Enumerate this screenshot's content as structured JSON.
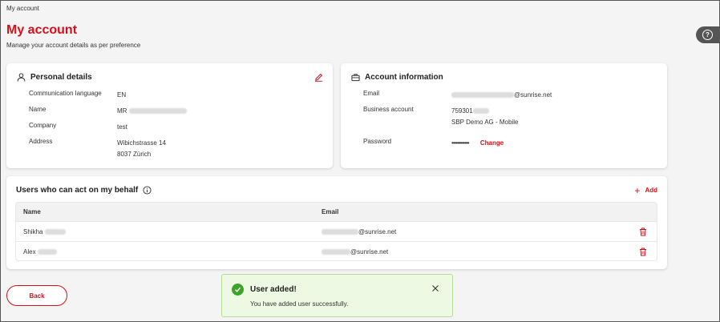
{
  "breadcrumb": "My account",
  "page": {
    "title": "My account",
    "subtitle": "Manage your account details as per preference"
  },
  "help": {
    "label": "?",
    "icon": "help-icon"
  },
  "personal": {
    "title": "Personal details",
    "rows": [
      {
        "label": "Communication language",
        "value": "EN"
      },
      {
        "label": "Name",
        "value": "MR"
      },
      {
        "label": "Company",
        "value": "test"
      },
      {
        "label": "Address",
        "line1": "Wibichstrasse 14",
        "line2": "8037 Zürich"
      }
    ]
  },
  "account": {
    "title": "Account information",
    "email_label": "Email",
    "email_suffix": "@sunrise.net",
    "business_label": "Business account",
    "business_prefix": "759301",
    "business_name": "SBP Demo AG - Mobile",
    "password_label": "Password",
    "password_mask": "••••••••••••",
    "change_label": "Change"
  },
  "users": {
    "title": "Users who can act on my behalf",
    "add_label": "Add",
    "columns": [
      "Name",
      "Email"
    ],
    "rows": [
      {
        "name": "Shikha",
        "email_suffix": "@sunrise.net"
      },
      {
        "name": "Alex",
        "email_suffix": "@sunrise.net"
      }
    ]
  },
  "back_label": "Back",
  "toast": {
    "title": "User added!",
    "message": "You have added user successfully."
  },
  "colors": {
    "brand": "#d3111b",
    "success": "#3ba52a",
    "toast_bg": "#eef9e4"
  }
}
